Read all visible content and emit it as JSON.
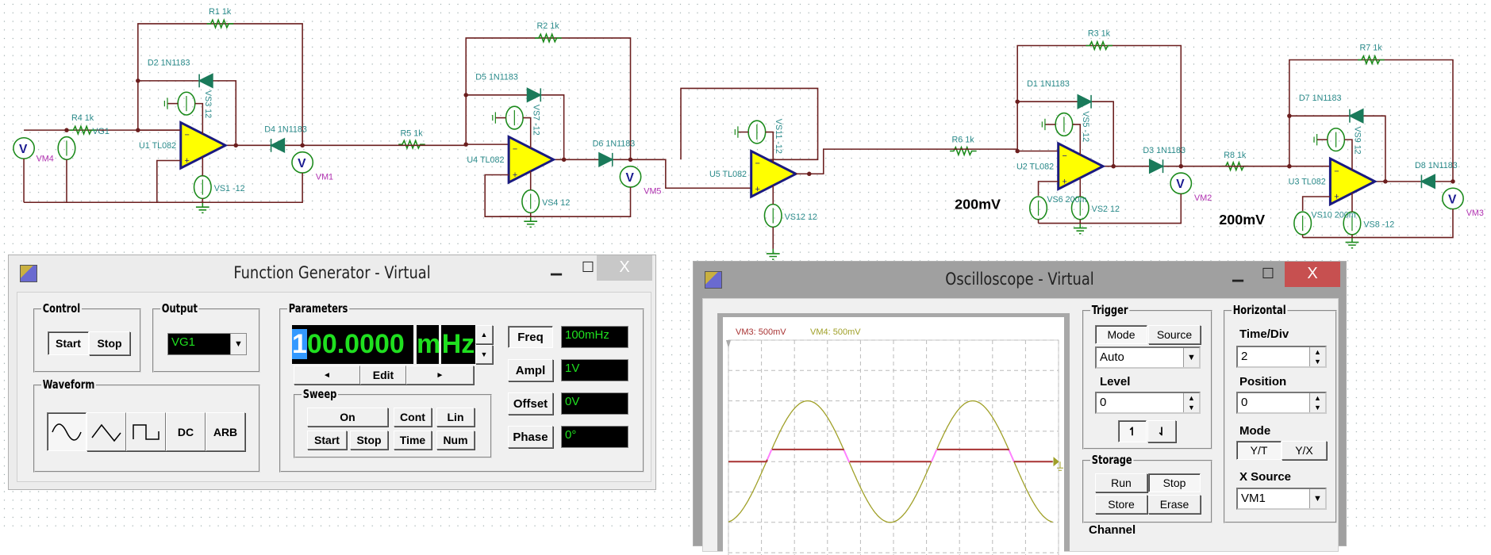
{
  "schematic": {
    "input": {
      "meter": "VM4",
      "resistor": "R4 1k",
      "generator": "VG1"
    },
    "stages": [
      {
        "opamp": "U1 TL082",
        "r_fb": "R1 1k",
        "d_fb": "D2 1N1183",
        "d_out": "D4 1N1183",
        "vs_top": "VS3 12",
        "vs_bot": "VS1 -12",
        "meter": "VM1"
      },
      {
        "opamp": "U4 TL082",
        "r_in": "R5 1k",
        "r_fb": "R2 1k",
        "d_fb": "D5 1N1183",
        "d_out": "D6 1N1183",
        "vs_top": "VS7 -12",
        "vs_bot": "VS4 12",
        "meter": "VM5"
      },
      {
        "opamp": "U2 TL082",
        "r_in": "R6 1k",
        "r_fb": "R3 1k",
        "d_fb": "D1 1N1183",
        "d_out": "D3 1N1183",
        "vs_top": "VS5 -12",
        "vs_bot": "VS2 12",
        "vs_ref": "VS6 200m",
        "meter": "VM2",
        "annotation": "200mV"
      },
      {
        "opamp": "U3 TL082",
        "r_in": "R8 1k",
        "r_fb": "R7 1k",
        "d_fb": "D7 1N1183",
        "d_out": "D8 1N1183",
        "vs_top": "VS9 12",
        "vs_bot": "VS8 -12",
        "vs_ref": "VS10 200m",
        "meter": "VM3",
        "annotation": "200mV"
      }
    ],
    "buffer": {
      "opamp": "U5 TL082",
      "vs_top": "VS11 -12",
      "vs_bot": "VS12 12"
    }
  },
  "function_generator": {
    "title": "Function Generator - Virtual",
    "control": {
      "label": "Control",
      "start": "Start",
      "stop": "Stop"
    },
    "output": {
      "label": "Output",
      "selected": "VG1"
    },
    "waveform": {
      "label": "Waveform",
      "dc": "DC",
      "arb": "ARB",
      "selected": "sine"
    },
    "parameters": {
      "label": "Parameters",
      "value_first": "1",
      "value_rest": "00.0000",
      "prefix": "m",
      "unit": "Hz",
      "left": "◄",
      "edit": "Edit",
      "right": "►"
    },
    "sweep": {
      "label": "Sweep",
      "on": "On",
      "cont": "Cont",
      "lin": "Lin",
      "start": "Start",
      "stop": "Stop",
      "time": "Time",
      "num": "Num"
    },
    "fields": [
      {
        "label": "Freq",
        "value": "100mHz"
      },
      {
        "label": "Ampl",
        "value": "1V"
      },
      {
        "label": "Offset",
        "value": "0V"
      },
      {
        "label": "Phase",
        "value": "0°"
      }
    ]
  },
  "oscilloscope": {
    "title": "Oscilloscope - Virtual",
    "trigger": {
      "label": "Trigger",
      "mode": "Mode",
      "source": "Source",
      "mode_value": "Auto",
      "level_label": "Level",
      "level": "0"
    },
    "storage": {
      "label": "Storage",
      "run": "Run",
      "stop": "Stop",
      "store": "Store",
      "erase": "Erase"
    },
    "channel_label": "Channel",
    "horizontal": {
      "label": "Horizontal",
      "time_div_label": "Time/Div",
      "time_div": "2",
      "position_label": "Position",
      "position": "0",
      "mode_label": "Mode",
      "yt": "Y/T",
      "yx": "Y/X",
      "xsource_label": "X Source",
      "xsource": "VM1"
    }
  },
  "chart_data": {
    "type": "line",
    "legend": [
      "VM3: 500mV",
      "VM4: 500mV"
    ],
    "colors": {
      "VM3": "#a83232",
      "VM4": "#a0a028",
      "VM3_transition": "#ff80ff"
    },
    "time_per_div_s": 2,
    "volts_per_div": 0.5,
    "xlim": [
      0,
      20
    ],
    "ylim": [
      -1.2,
      2
    ],
    "grid": true,
    "series": [
      {
        "name": "VM4",
        "shape": "sine",
        "amplitude": 1,
        "frequency_Hz": 0.1,
        "rising_zero_crossing_s": 2.3
      },
      {
        "name": "VM3",
        "shape": "VM4 clipped",
        "clip": [
          0,
          0.2
        ]
      }
    ]
  }
}
